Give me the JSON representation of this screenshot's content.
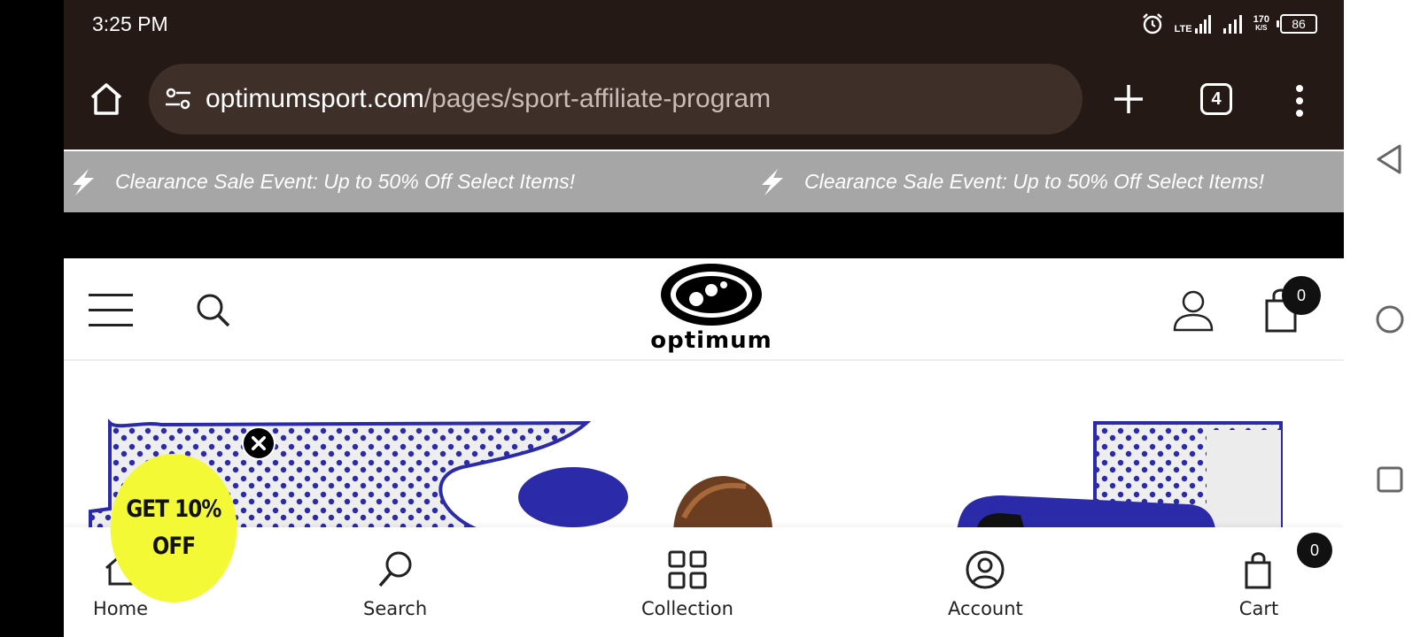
{
  "status_bar": {
    "time": "3:25 PM",
    "network": "LTE",
    "speed_value": "170",
    "speed_unit": "K/S",
    "battery": "86"
  },
  "browser": {
    "url_domain": "optimumsport.com",
    "url_path": "/pages/sport-affiliate-program",
    "tab_count": "4"
  },
  "announcement": {
    "items": [
      "Clearance Sale Event: Up to 50% Off Select Items!",
      "Clearance Sale Event: Up to 50% Off Select Items!"
    ]
  },
  "header": {
    "logo_text": "optimum",
    "cart_count": "0"
  },
  "popup": {
    "discount_line1": "GET 10%",
    "discount_line2": "OFF"
  },
  "bottom_nav": {
    "items": [
      {
        "label": "Home",
        "icon": "home-icon"
      },
      {
        "label": "Search",
        "icon": "search-icon"
      },
      {
        "label": "Collection",
        "icon": "grid-icon"
      },
      {
        "label": "Account",
        "icon": "account-icon"
      },
      {
        "label": "Cart",
        "icon": "cart-icon"
      }
    ],
    "cart_count": "0"
  },
  "colors": {
    "chrome_bg": "#241914",
    "urlbar_bg": "#3e2f28",
    "announce_bg": "#a6a6a6",
    "hero_blue": "#2b2baa",
    "popup_yellow": "#f3fa35"
  }
}
